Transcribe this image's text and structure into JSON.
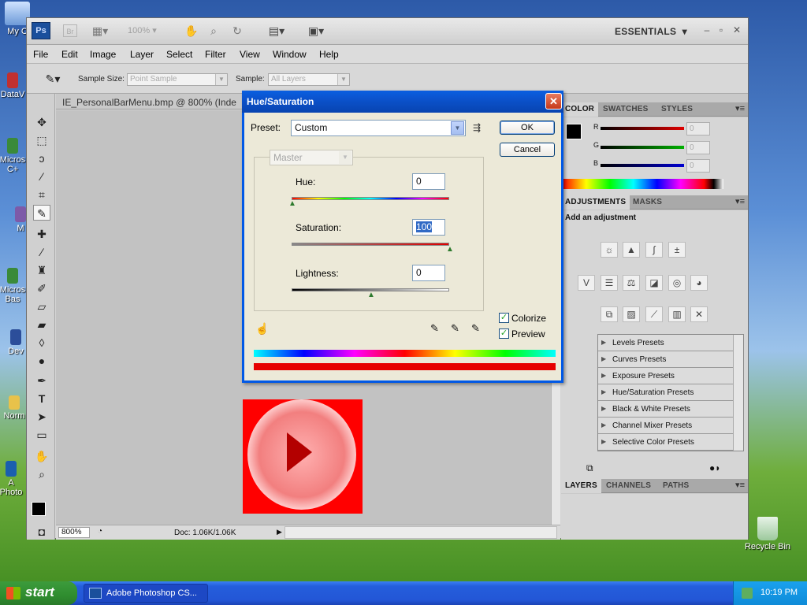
{
  "desktop": {
    "icons": [
      {
        "label": "My C",
        "icon": "my-computer-icon"
      },
      {
        "label": "DataV",
        "icon": "app-icon"
      },
      {
        "label": "Micros",
        "label2": "C+",
        "icon": "app-icon"
      },
      {
        "label": "M",
        "icon": "app-icon"
      },
      {
        "label": "Micros",
        "label2": "Bas",
        "icon": "app-icon"
      },
      {
        "label": "Dev",
        "icon": "app-icon"
      },
      {
        "label": "Norm",
        "icon": "folder-icon"
      },
      {
        "label": "A",
        "label2": "Photo",
        "icon": "app-icon"
      }
    ],
    "recycle_bin": "Recycle Bin"
  },
  "photoshop": {
    "zoom_level": "100%",
    "workspace": "ESSENTIALS",
    "menu": [
      "File",
      "Edit",
      "Image",
      "Layer",
      "Select",
      "Filter",
      "View",
      "Window",
      "Help"
    ],
    "options": {
      "sample_size_label": "Sample Size:",
      "sample_size_value": "Point Sample",
      "sample_label": "Sample:",
      "sample_value": "All Layers"
    },
    "document": {
      "tab_title": "IE_PersonalBarMenu.bmp @ 800% (Inde",
      "zoom": "800%",
      "doc_info": "Doc: 1.06K/1.06K"
    },
    "color_panel": {
      "tabs": [
        "COLOR",
        "SWATCHES",
        "STYLES"
      ],
      "channels": [
        {
          "label": "R",
          "value": "0",
          "color": "#e00000"
        },
        {
          "label": "G",
          "value": "0",
          "color": "#00b000"
        },
        {
          "label": "B",
          "value": "0",
          "color": "#0000d0"
        }
      ]
    },
    "adjustments_panel": {
      "tabs": [
        "ADJUSTMENTS",
        "MASKS"
      ],
      "heading": "Add an adjustment",
      "presets": [
        "Levels Presets",
        "Curves Presets",
        "Exposure Presets",
        "Hue/Saturation Presets",
        "Black & White Presets",
        "Channel Mixer Presets",
        "Selective Color Presets"
      ]
    },
    "layers_panel": {
      "tabs": [
        "LAYERS",
        "CHANNELS",
        "PATHS"
      ]
    }
  },
  "dialog": {
    "title": "Hue/Saturation",
    "close": "✕",
    "preset_label": "Preset:",
    "preset_value": "Custom",
    "ok": "OK",
    "cancel": "Cancel",
    "channel": "Master",
    "hue_label": "Hue:",
    "hue_value": "0",
    "saturation_label": "Saturation:",
    "saturation_value": "100",
    "lightness_label": "Lightness:",
    "lightness_value": "0",
    "colorize_label": "Colorize",
    "colorize_checked": true,
    "preview_label": "Preview",
    "preview_checked": true
  },
  "taskbar": {
    "start": "start",
    "task": "Adobe Photoshop CS...",
    "clock": "10:19 PM"
  }
}
